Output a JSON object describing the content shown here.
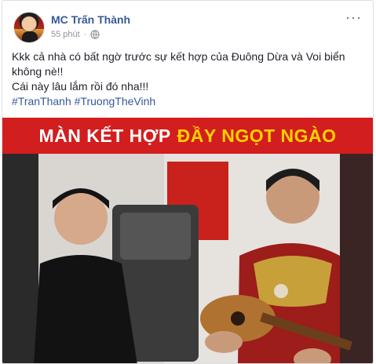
{
  "post": {
    "author": "MC Trấn Thành",
    "time": "55 phút",
    "privacy_icon": "globe-icon",
    "more_icon": "more-options-icon",
    "line1": "Kkk cả nhà có bất ngờ trước sự kết hợp của Đuông Dừa và Voi biển không nè!!",
    "line2": "Cái này lâu lắm rồi đó nha!!!",
    "hashtags": [
      "#TranThanh",
      "#TruongTheVinh"
    ]
  },
  "video": {
    "banner_white": "MÀN KẾT HỢP",
    "banner_highlight": "ĐẦY NGỌT NGÀO",
    "banner_color": "#d21e1e",
    "highlight_color": "#ffd200"
  }
}
